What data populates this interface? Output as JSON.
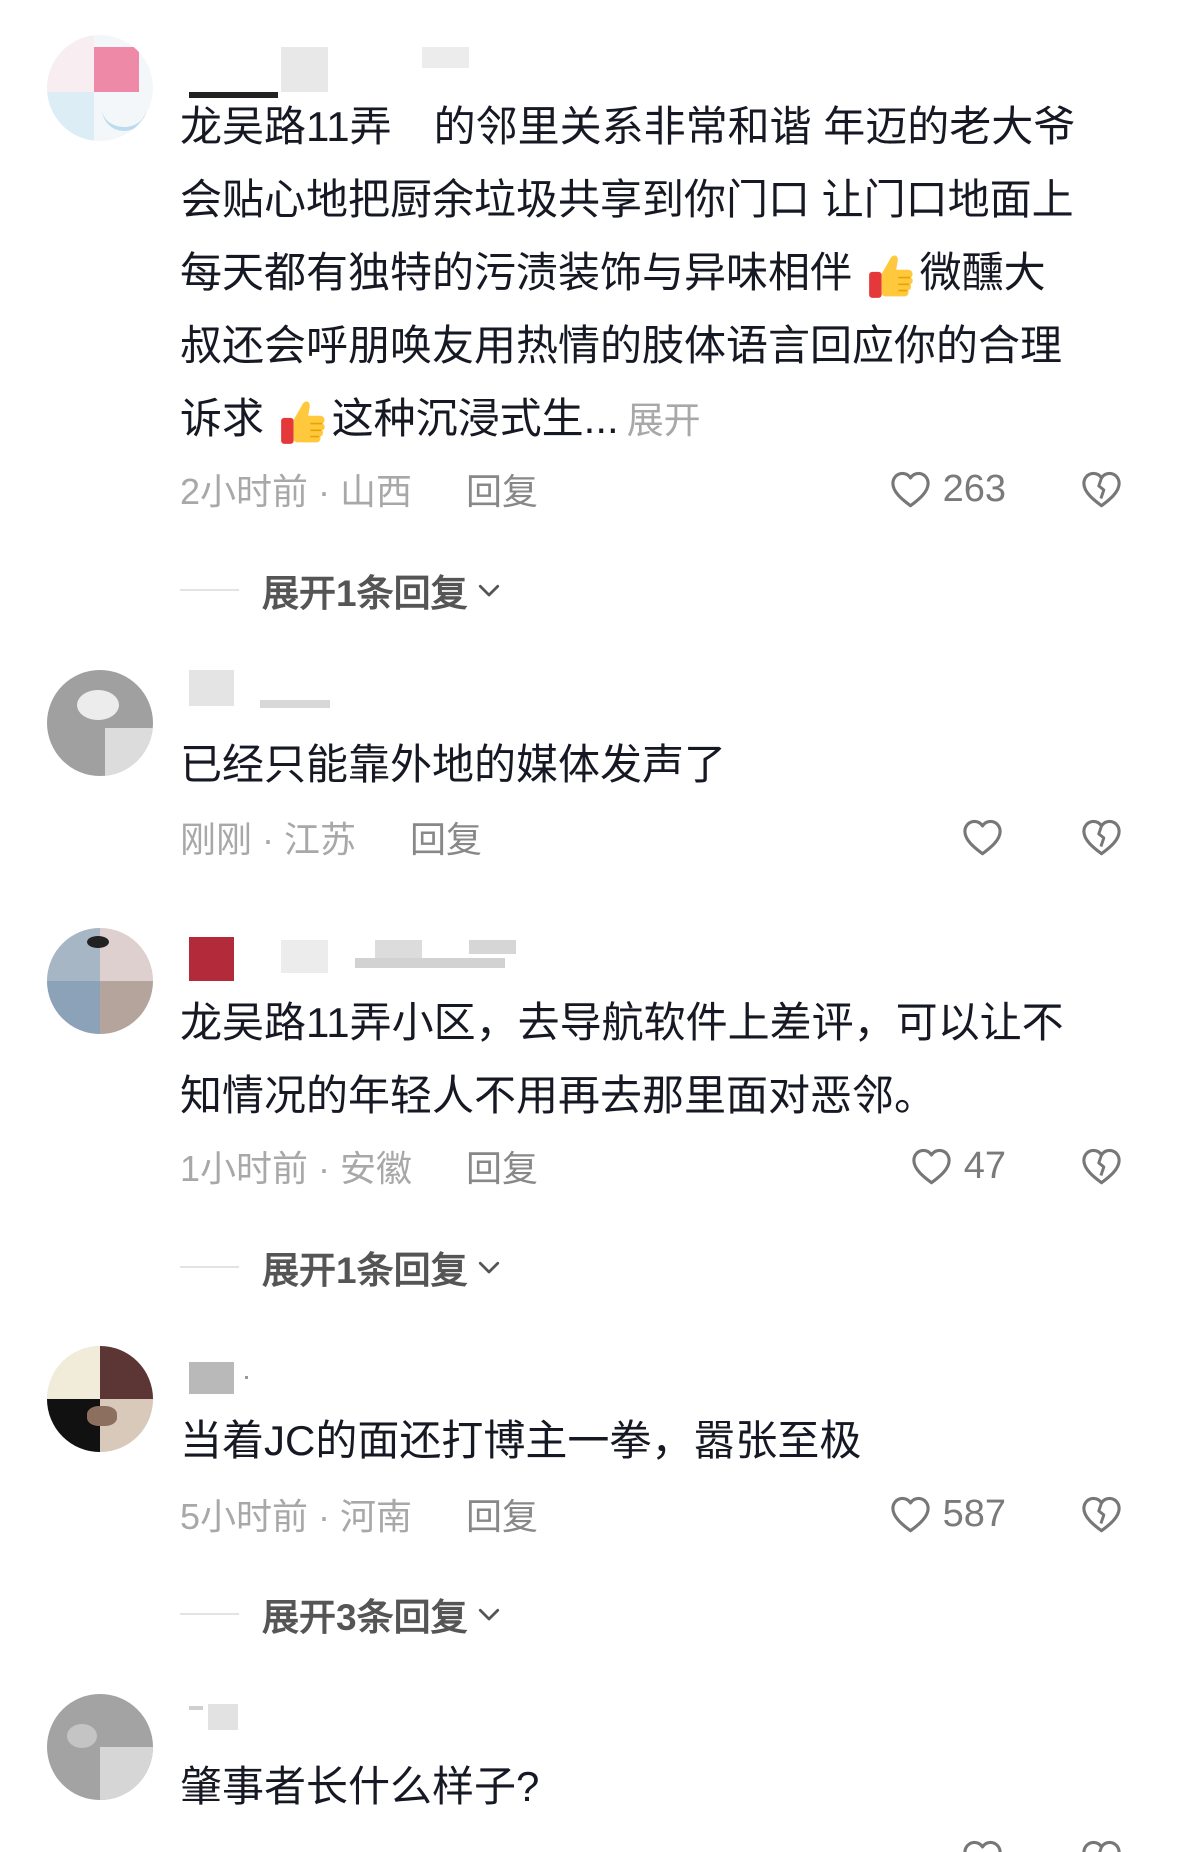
{
  "comments": [
    {
      "lines": [
        {
          "text": "龙吴路11弄　的邻里关系非常和谐 年迈的老大爷"
        },
        {
          "text": "会贴心地把厨余垃圾共享到你门口 让门口地面上"
        },
        {
          "text": "每天都有独特的污渍装饰与异味相伴 ",
          "icon": "thumbs-up-emoji",
          "after": "微醺大"
        },
        {
          "text": "叔还会呼朋唤友用热情的肢体语言回应你的合理"
        },
        {
          "text": "诉求 ",
          "icon": "thumbs-up-emoji",
          "after": "这种沉浸式生..."
        }
      ],
      "expand_text": "展开",
      "meta": "2小时前 · 山西",
      "reply_label": "回复",
      "likes": "263",
      "replies_toggle": "展开1条回复"
    },
    {
      "lines": [
        {
          "text": "已经只能靠外地的媒体发声了"
        }
      ],
      "meta": "刚刚 · 江苏",
      "reply_label": "回复"
    },
    {
      "lines": [
        {
          "text": "龙吴路11弄小区，去导航软件上差评，可以让不"
        },
        {
          "text": "知情况的年轻人不用再去那里面对恶邻。"
        }
      ],
      "meta": "1小时前 · 安徽",
      "reply_label": "回复",
      "likes": "47",
      "replies_toggle": "展开1条回复"
    },
    {
      "lines": [
        {
          "text": "当着JC的面还打博主一拳，嚣张至极"
        }
      ],
      "meta": "5小时前 · 河南",
      "reply_label": "回复",
      "likes": "587",
      "replies_toggle": "展开3条回复"
    },
    {
      "lines": [
        {
          "text": "肇事者长什么样子?"
        }
      ]
    }
  ],
  "icons": {
    "like": "heart-outline-icon",
    "dislike": "broken-heart-icon",
    "toggle": "chevron-down-icon",
    "emoji": "thumbs-up-emoji"
  },
  "colors": {
    "text": "#161823",
    "meta": "#a8a8a8",
    "reply": "#888888",
    "toggle": "#555555",
    "icon_stroke": "#777777"
  }
}
